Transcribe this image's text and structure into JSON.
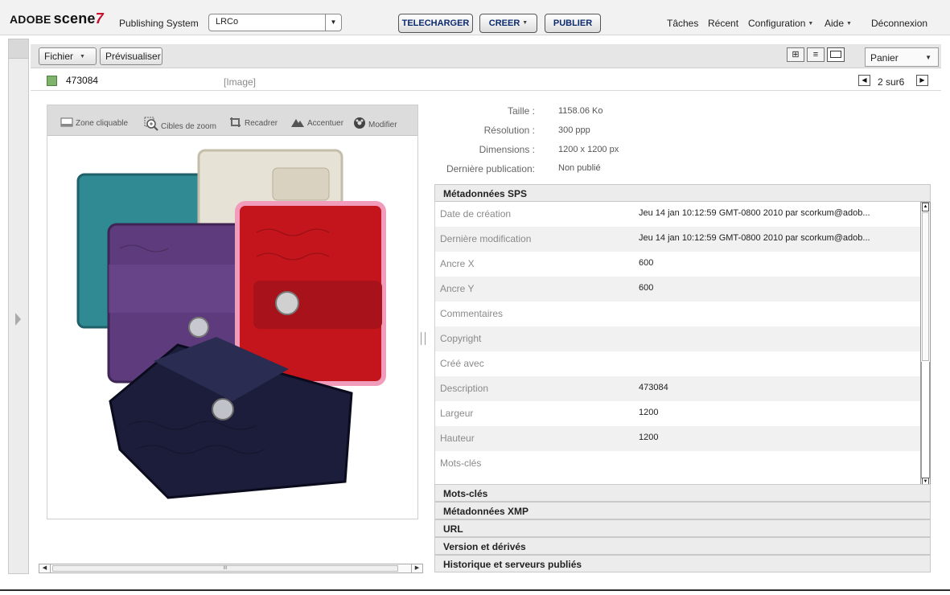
{
  "header": {
    "brand": "ADOBE",
    "product": "scene",
    "product_mark": "7",
    "system_name": "Publishing System",
    "company": "LRCo",
    "buttons": {
      "telecharger": "TELECHARGER",
      "creer": "CREER",
      "publier": "PUBLIER"
    },
    "menu": {
      "taches": "Tâches",
      "recent": "Récent",
      "configuration": "Configuration",
      "aide": "Aide",
      "deconnexion": "Déconnexion"
    }
  },
  "toolbar": {
    "fichier": "Fichier",
    "previsualiser": "Prévisualiser",
    "cart": "Panier"
  },
  "asset": {
    "id": "473084",
    "type": "[Image]",
    "pagination": "2 sur6"
  },
  "preview_tools": [
    {
      "label": "Zone cliquable",
      "icon": "hotspot-zone-icon"
    },
    {
      "label": "Cibles de zoom",
      "icon": "zoom-target-icon"
    },
    {
      "label": "Recadrer",
      "icon": "crop-icon"
    },
    {
      "label": "Accentuer",
      "icon": "sharpen-icon"
    },
    {
      "label": "Modifier",
      "icon": "edit-icon"
    }
  ],
  "info": {
    "size_label": "Taille :",
    "size_value": "1158.06 Ko",
    "resolution_label": "Résolution :",
    "resolution_value": "300 ppp",
    "dimensions_label": "Dimensions :",
    "dimensions_value": "1200 x 1200 px",
    "last_pub_label": "Dernière publication:",
    "last_pub_value": "Non publié"
  },
  "metadata": {
    "title": "Métadonnées SPS",
    "rows": [
      {
        "key": "Date de création",
        "value": "Jeu 14 jan 10:12:59 GMT-0800 2010 par scorkum@adob..."
      },
      {
        "key": "Dernière modification",
        "value": "Jeu 14 jan 10:12:59 GMT-0800 2010 par scorkum@adob..."
      },
      {
        "key": "Ancre X",
        "value": "600"
      },
      {
        "key": "Ancre Y",
        "value": "600"
      },
      {
        "key": "Commentaires",
        "value": ""
      },
      {
        "key": "Copyright",
        "value": ""
      },
      {
        "key": "Créé avec",
        "value": ""
      },
      {
        "key": "Description",
        "value": "473084"
      },
      {
        "key": "Largeur",
        "value": "1200"
      },
      {
        "key": "Hauteur",
        "value": "1200"
      },
      {
        "key": "Mots-clés",
        "value": ""
      }
    ]
  },
  "sections": {
    "mots_cles": "Mots-clés",
    "xmp": "Métadonnées XMP",
    "url": "URL",
    "version": "Version et dérivés",
    "historique": "Historique et serveurs publiés"
  },
  "colors": {
    "button_text": "#0b2a6e",
    "brand_red": "#c8102e",
    "asset_swatch": "#7fb36b"
  }
}
